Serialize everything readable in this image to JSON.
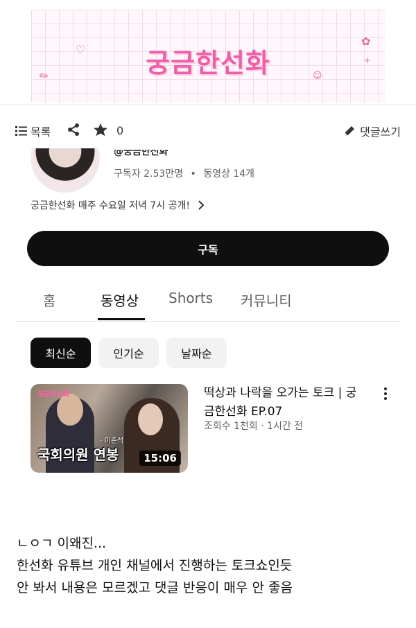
{
  "banner": {
    "logo_text": "궁금한선화"
  },
  "toolbar": {
    "list_label": "목록",
    "star_count": "0",
    "write_label": "댓글쓰기"
  },
  "channel": {
    "handle": "@궁금한선화",
    "subscribers": "구독자 2.53만명",
    "separator": "•",
    "videos": "동영상 14개",
    "description": "궁금한선화 매주 수요일 저녁 7시 공개!",
    "subscribe_label": "구독"
  },
  "tabs": [
    {
      "label": "홈",
      "active": false
    },
    {
      "label": "동영상",
      "active": true
    },
    {
      "label": "Shorts",
      "active": false
    },
    {
      "label": "커뮤니티",
      "active": false
    }
  ],
  "chips": [
    {
      "label": "최신순",
      "active": true
    },
    {
      "label": "인기순",
      "active": false
    },
    {
      "label": "날짜순",
      "active": false
    }
  ],
  "video": {
    "title": "떡상과 나락을 오가는 토크 | 궁금한선화 EP.07",
    "meta": "조회수 1천회 · 1시간 전",
    "duration": "15:06",
    "thumb_caption": "국회의원 연봉",
    "thumb_small_caption": "- 이준석",
    "thumb_logo": "궁금한선화"
  },
  "comment": {
    "lines": [
      "ㄴㅇㄱ 이왜진...",
      "한선화 유튜브 개인 채널에서 진행하는 토크쇼인듯",
      "안 봐서 내용은 모르겠고 댓글 반응이 매우 안 좋음"
    ]
  },
  "colors": {
    "accent_pink": "#ee5fa7",
    "black": "#0f0f0f",
    "chip_bg": "#f2f2f2"
  },
  "icons": {
    "list": "list-icon",
    "share": "share-icon",
    "star": "star-icon",
    "write": "pencil-icon",
    "chevron": "chevron-right-icon",
    "more": "more-vertical-icon"
  }
}
